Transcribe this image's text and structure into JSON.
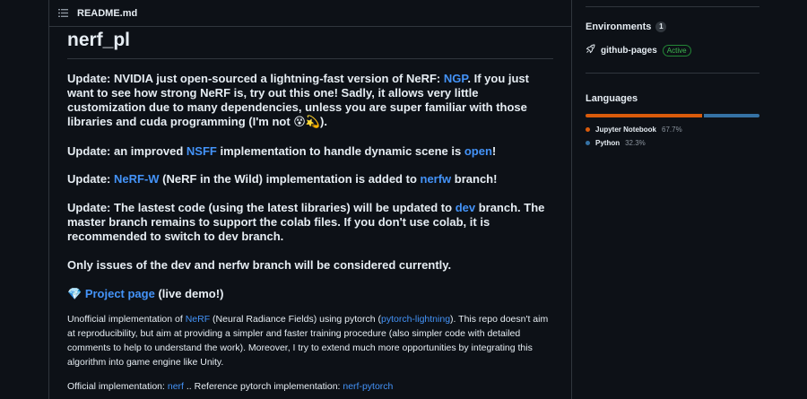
{
  "readme": {
    "filename": "README.md",
    "title": "nerf_pl",
    "update1": {
      "pre": "Update: NVIDIA just open-sourced a lightning-fast version of NeRF: ",
      "link": "NGP",
      "post": ". If you just want to see how strong NeRF is, try out this one! Sadly, it allows very little customization due to many dependencies, unless you are super familiar with those libraries and cuda programming (I'm not ",
      "emoji": "😵💫",
      "end": ")."
    },
    "update2": {
      "pre": "Update: an improved ",
      "link1": "NSFF",
      "mid": " implementation to handle dynamic scene is ",
      "link2": "open",
      "post": "!"
    },
    "update3": {
      "pre": "Update: ",
      "link1": "NeRF-W",
      "mid": " (NeRF in the Wild) implementation is added to ",
      "link2": "nerfw",
      "post": " branch!"
    },
    "update4": {
      "pre": "Update: The lastest code (using the latest libraries) will be updated to ",
      "link": "dev",
      "post": " branch. The master branch remains to support the colab files. If you don't use colab, it is recommended to switch to dev branch."
    },
    "issues_note": "Only issues of the dev and nerfw branch will be considered currently.",
    "project": {
      "emoji": "💎",
      "link": "Project page",
      "post": " (live demo!)"
    },
    "description": {
      "pre": "Unofficial implementation of ",
      "link1": "NeRF",
      "mid": " (Neural Radiance Fields) using pytorch (",
      "link2": "pytorch-lightning",
      "post": "). This repo doesn't aim at reproducibility, but aim at providing a simpler and faster training procedure (also simpler code with detailed comments to help to understand the work). Moreover, I try to extend much more opportunities by integrating this algorithm into game engine like Unity."
    },
    "official": {
      "pre": "Official implementation: ",
      "link1": "nerf",
      "mid": " .. Reference pytorch implementation: ",
      "link2": "nerf-pytorch"
    }
  },
  "sidebar": {
    "environments": {
      "title": "Environments",
      "count": "1",
      "items": [
        {
          "name": "github-pages",
          "status": "Active"
        }
      ]
    },
    "languages": {
      "title": "Languages",
      "items": [
        {
          "name": "Jupyter Notebook",
          "percent": "67.7%",
          "fraction": 0.677,
          "color": "#DA5B0B"
        },
        {
          "name": "Python",
          "percent": "32.3%",
          "fraction": 0.323,
          "color": "#3572A5"
        }
      ]
    }
  }
}
